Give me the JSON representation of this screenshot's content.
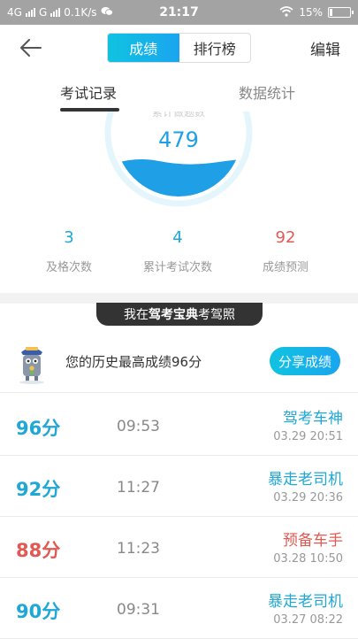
{
  "status_bar": {
    "network1": "4G",
    "network2": "G",
    "speed": "0.1K/s",
    "time": "21:17",
    "battery": "15%"
  },
  "nav": {
    "tab_scores": "成绩",
    "tab_rank": "排行榜",
    "edit": "编辑"
  },
  "tabs": {
    "records": "考试记录",
    "stats": "数据统计"
  },
  "gauge": {
    "label": "累计做题数",
    "value": "479",
    "fill_fraction": 0.45
  },
  "stats": [
    {
      "value": "3",
      "label": "及格次数",
      "color": "#1fa7d6"
    },
    {
      "value": "4",
      "label": "累计考试次数",
      "color": "#1fa7d6"
    },
    {
      "value": "92",
      "label": "成绩预测",
      "color": "#e05a53"
    }
  ],
  "banner": {
    "prefix": "我在",
    "brand": "驾考宝典",
    "suffix": "考驾照"
  },
  "best": {
    "text": "您的历史最高成绩96分",
    "share": "分享成绩"
  },
  "records": [
    {
      "score": "96分",
      "duration": "09:53",
      "title": "驾考车神",
      "date": "03.29  20:51",
      "color": "#1fa7d6"
    },
    {
      "score": "92分",
      "duration": "11:27",
      "title": "暴走老司机",
      "date": "03.29  20:36",
      "color": "#1fa7d6"
    },
    {
      "score": "88分",
      "duration": "11:23",
      "title": "预备车手",
      "date": "03.28  10:50",
      "color": "#e05a53"
    },
    {
      "score": "90分",
      "duration": "09:31",
      "title": "暴走老司机",
      "date": "03.27  08:22",
      "color": "#1fa7d6"
    }
  ],
  "colors": {
    "accent": "#1aa5ef",
    "pass": "#1fa7d6",
    "fail": "#e05a53"
  }
}
